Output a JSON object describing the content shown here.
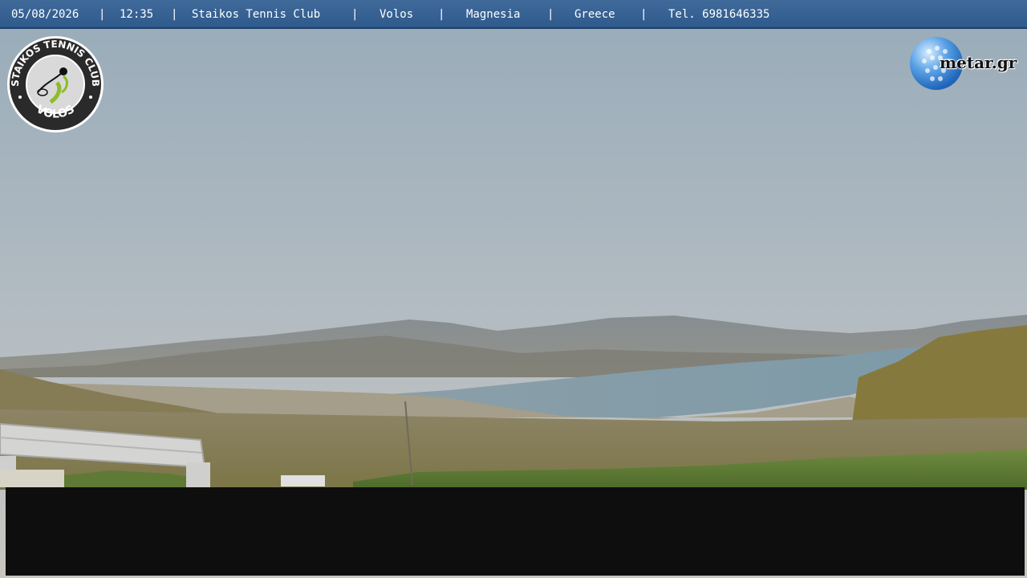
{
  "overlay": {
    "date": "05/08/2026",
    "time": "12:35",
    "club": "Staikos Tennis Club",
    "city": "Volos",
    "region": "Magnesia",
    "country": "Greece",
    "phone": "Tel. 6981646335",
    "separator": "|"
  },
  "logos": {
    "club_logo_text_top": "STAIKOS TENNIS CLUB",
    "club_logo_text_bottom": "VOLOS",
    "metar_brand": "metar.gr"
  },
  "colors": {
    "bar": "#2f5a8c",
    "sky_top": "#9fb0bd",
    "sea": "#7f9ba8",
    "panel": "#0e0e0e"
  }
}
